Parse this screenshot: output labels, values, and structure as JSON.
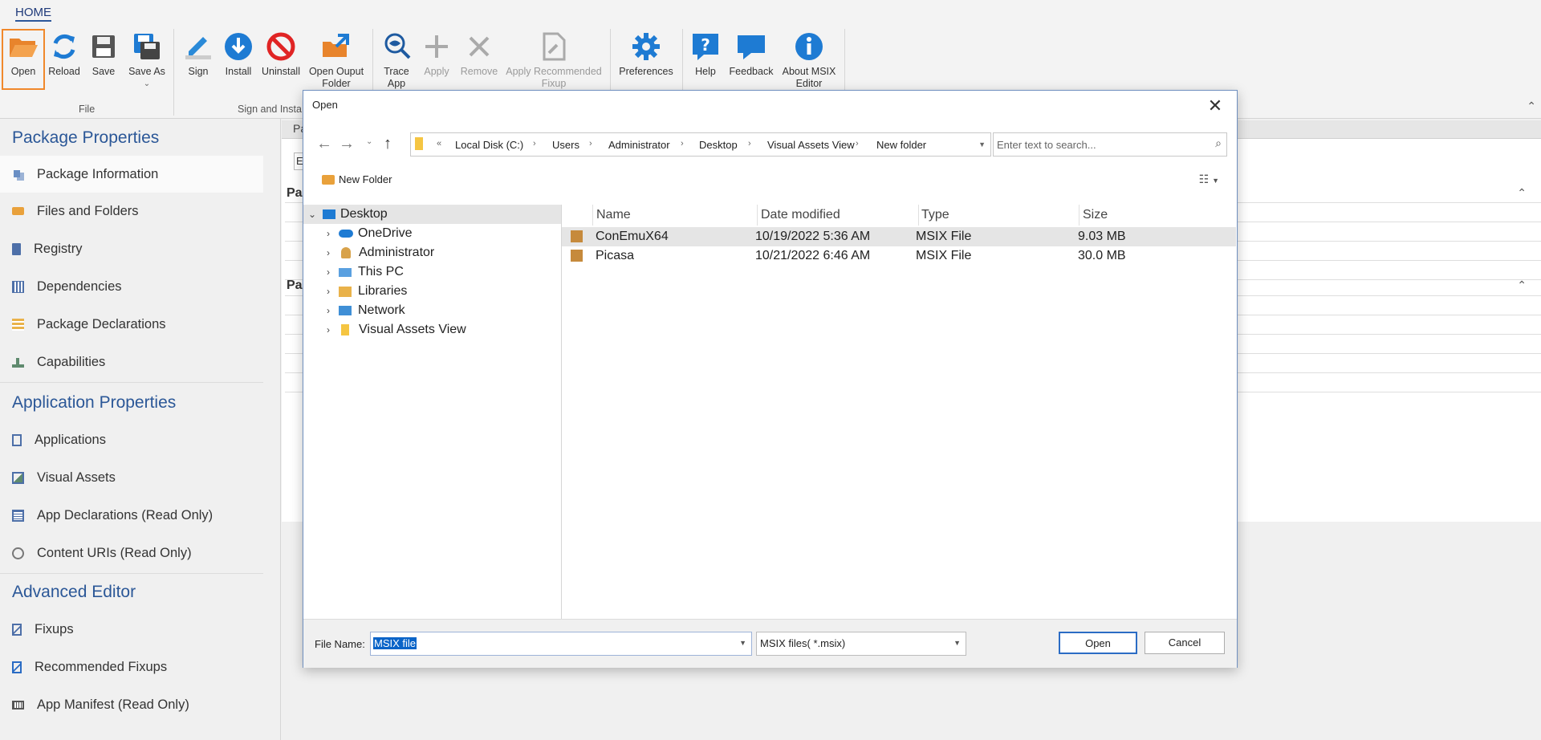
{
  "ribbon": {
    "tab": "HOME",
    "buttons": [
      {
        "label": "Open"
      },
      {
        "label": "Reload"
      },
      {
        "label": "Save"
      },
      {
        "label": "Save As"
      },
      {
        "label": "Sign"
      },
      {
        "label": "Install"
      },
      {
        "label": "Uninstall"
      },
      {
        "label": "Open Ouput Folder"
      },
      {
        "label": "Trace App"
      },
      {
        "label": "Apply"
      },
      {
        "label": "Remove"
      },
      {
        "label": "Apply Recommended Fixup"
      },
      {
        "label": "Preferences"
      },
      {
        "label": "Help"
      },
      {
        "label": "Feedback"
      },
      {
        "label": "About MSIX Editor"
      }
    ],
    "groups": {
      "file": "File",
      "sign_install": "Sign and Insta"
    }
  },
  "sidebar": {
    "package_properties": "Package Properties",
    "package_items": [
      "Package Information",
      "Files and Folders",
      "Registry",
      "Dependencies",
      "Package Declarations",
      "Capabilities"
    ],
    "application_properties": "Application Properties",
    "application_items": [
      "Applications",
      "Visual Assets",
      "App Declarations (Read Only)",
      "Content URIs (Read Only)"
    ],
    "advanced_editor": "Advanced Editor",
    "advanced_items": [
      "Fixups",
      "Recommended Fixups",
      "App Manifest (Read Only)"
    ]
  },
  "main": {
    "tab_fragment": "Pa",
    "header_fragment_1": "Pa",
    "header_fragment_2": "Pa",
    "field_fragment": "E"
  },
  "dialog": {
    "title": "Open",
    "address": [
      "Local Disk (C:)",
      "Users",
      "Administrator",
      "Desktop",
      "Visual Assets View",
      "New folder"
    ],
    "search_placeholder": "Enter text to search...",
    "new_folder": "New Folder",
    "tree": [
      {
        "label": "Desktop"
      },
      {
        "label": "OneDrive"
      },
      {
        "label": "Administrator"
      },
      {
        "label": "This PC"
      },
      {
        "label": "Libraries"
      },
      {
        "label": "Network"
      },
      {
        "label": "Visual Assets View"
      }
    ],
    "columns": {
      "name": "Name",
      "date": "Date modified",
      "type": "Type",
      "size": "Size"
    },
    "files": [
      {
        "name": "ConEmuX64",
        "date": "10/19/2022 5:36 AM",
        "type": "MSIX File",
        "size": "9.03 MB"
      },
      {
        "name": "Picasa",
        "date": "10/21/2022 6:46 AM",
        "type": "MSIX File",
        "size": "30.0 MB"
      }
    ],
    "file_name_label": "File Name:",
    "file_name_value": "MSIX file",
    "file_type": "MSIX files( *.msix)",
    "open_button": "Open",
    "cancel_button": "Cancel"
  },
  "colors": {
    "accent": "#2b5797",
    "highlight_orange": "#f0882b",
    "selection_blue": "#0a64c8"
  }
}
